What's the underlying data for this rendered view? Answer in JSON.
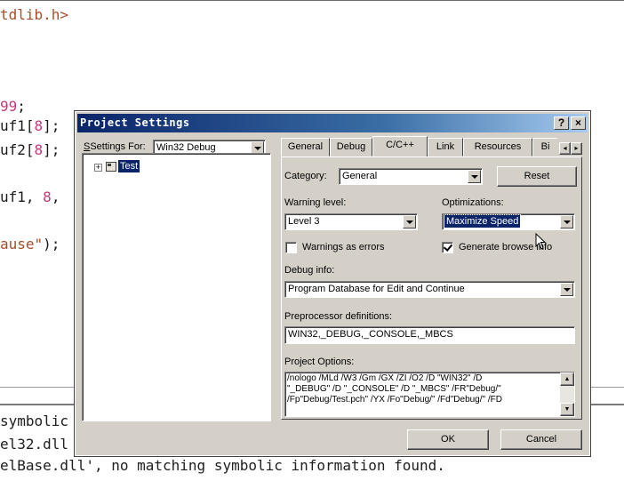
{
  "editor": {
    "lines": [
      {
        "a": "tdlib.h>",
        "b": "",
        "c": ""
      },
      {
        "a": "99",
        "b": ";",
        "c": ""
      },
      {
        "a": "uf1[",
        "b": "8",
        "c": "];"
      },
      {
        "a": "uf2[",
        "b": "8",
        "c": "];"
      },
      {
        "a": "uf1, ",
        "b": "8",
        "c": ","
      },
      {
        "a": "ause\"",
        "b": ");",
        "c": ""
      }
    ]
  },
  "output": {
    "line1": "symbolic",
    "line2": "el32.dll",
    "line3": "elBase.dll', no matching symbolic information found."
  },
  "dialog": {
    "title": "Project Settings",
    "help_btn": "?",
    "close_btn": "×",
    "settings_for_label": "Settings For:",
    "settings_for_value": "Win32 Debug",
    "tree": {
      "expander": "+",
      "item": "Test"
    },
    "tabs": [
      {
        "label": "General"
      },
      {
        "label": "Debug"
      },
      {
        "label": "C/C++"
      },
      {
        "label": "Link"
      },
      {
        "label": "Resources"
      },
      {
        "label": "Bi"
      }
    ],
    "category_label": "Category:",
    "category_value": "General",
    "reset_btn": "Reset",
    "warning_label": "Warning level:",
    "warning_value": "Level 3",
    "optim_label": "Optimizations:",
    "optim_value": "Maximize Speed",
    "warn_err_label": "Warnings as errors",
    "warn_err_checked": false,
    "browse_label": "Generate browse info",
    "browse_checked": true,
    "debug_info_label": "Debug info:",
    "debug_info_value": "Program Database for Edit and Continue",
    "preproc_label": "Preprocessor definitions:",
    "preproc_value": "WIN32,_DEBUG,_CONSOLE,_MBCS",
    "proj_opts_label": "Project Options:",
    "proj_opts_lines": [
      "/nologo /MLd /W3 /Gm /GX /ZI /O2 /D \"WIN32\" /D",
      "\"_DEBUG\" /D \"_CONSOLE\" /D \"_MBCS\" /FR\"Debug/\"",
      "/Fp\"Debug/Test.pch\" /YX /Fo\"Debug/\" /Fd\"Debug/\" /FD"
    ],
    "ok_btn": "OK",
    "cancel_btn": "Cancel"
  },
  "colors": {
    "title_gradient_start": "#0a246a",
    "dialog_face": "#d4d0c8",
    "selection": "#0a246a",
    "code_pink": "#c8387a"
  }
}
